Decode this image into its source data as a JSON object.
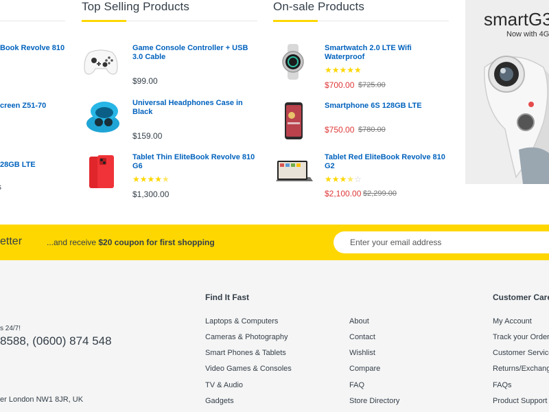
{
  "left_column": {
    "items": [
      {
        "title": "Book Revolve 810"
      },
      {
        "title": "creen Z51-70"
      },
      {
        "title": "28GB LTE"
      }
    ]
  },
  "top_selling": {
    "heading": "Top Selling Products",
    "items": [
      {
        "title_line1": "Game Console Controller + USB",
        "title_line2": "3.0 Cable",
        "price": "$99.00",
        "icon": "game-controller-icon"
      },
      {
        "title_line1": "Universal Headphones Case in",
        "title_line2": "Black",
        "price": "$159.00",
        "icon": "headphones-case-icon"
      },
      {
        "title_line1": "Tablet Thin EliteBook Revolve 810",
        "title_line2": "G6",
        "price": "$1,300.00",
        "rating": 4.5,
        "icon": "red-phone-icon"
      }
    ]
  },
  "on_sale": {
    "heading": "On-sale Products",
    "items": [
      {
        "title_line1": "Smartwatch 2.0 LTE Wifi",
        "title_line2": "Waterproof",
        "price": "$700.00",
        "old_price": "$725.00",
        "rating": 5,
        "icon": "smartwatch-icon"
      },
      {
        "title_line1": "Smartphone 6S 128GB LTE",
        "title_line2": "",
        "price": "$750.00",
        "old_price": "$780.00",
        "icon": "smartphone-icon"
      },
      {
        "title_line1": "Tablet Red EliteBook Revolve 810",
        "title_line2": "G2",
        "price": "$2,100.00",
        "old_price": "$2,299.00",
        "rating": 3.5,
        "icon": "tablet-icon"
      }
    ]
  },
  "promo": {
    "title": "smartG3",
    "subtitle": "Now with 4G"
  },
  "newsletter": {
    "title": "etter",
    "text_prefix": "...and receive ",
    "text_bold": "$20 coupon for first shopping",
    "placeholder": "Enter your email address"
  },
  "footer": {
    "contact": {
      "hours": "s 24/7!",
      "phone": "8588, (0600) 874 548",
      "address": "er London NW1 8JR, UK"
    },
    "find_it_fast": {
      "heading": "Find It Fast",
      "col1": [
        "Laptops & Computers",
        "Cameras & Photography",
        "Smart Phones & Tablets",
        "Video Games & Consoles",
        "TV & Audio",
        "Gadgets"
      ],
      "col2": [
        "About",
        "Contact",
        "Wishlist",
        "Compare",
        "FAQ",
        "Store Directory"
      ]
    },
    "customer_care": {
      "heading": "Customer Care",
      "links": [
        "My Account",
        "Track your Order",
        "Customer Service",
        "Returns/Exchange",
        "FAQs",
        "Product Support"
      ]
    }
  },
  "colors": {
    "accent": "#fed700",
    "link": "#0062bd",
    "sale": "#df3737"
  }
}
